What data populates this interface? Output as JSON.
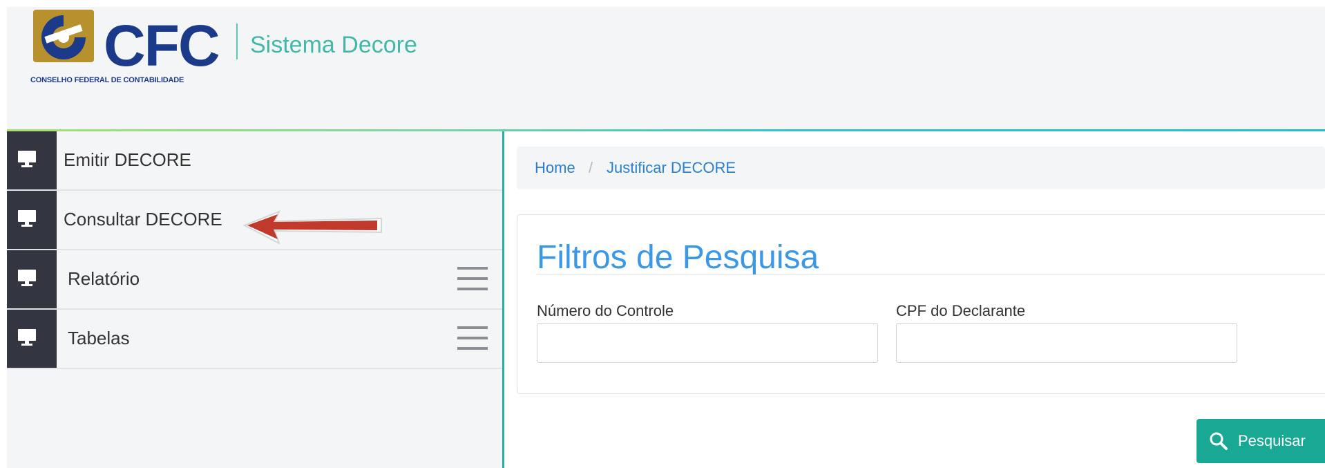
{
  "header": {
    "logo_abbr": "CFC",
    "logo_full_name": "CONSELHO FEDERAL DE CONTABILIDADE",
    "app_title": "Sistema Decore"
  },
  "sidebar": {
    "items": [
      {
        "label": "Emitir DECORE",
        "icon": "monitor-icon",
        "has_menu": false
      },
      {
        "label": "Consultar DECORE",
        "icon": "monitor-icon",
        "has_menu": false
      },
      {
        "label": "Relatório",
        "icon": "monitor-icon",
        "has_menu": true
      },
      {
        "label": "Tabelas",
        "icon": "monitor-icon",
        "has_menu": true
      }
    ]
  },
  "breadcrumb": {
    "home": "Home",
    "separator": "/",
    "current": "Justificar DECORE"
  },
  "filters": {
    "title": "Filtros de Pesquisa",
    "fields": [
      {
        "label": "Número do Controle",
        "value": ""
      },
      {
        "label": "CPF do Declarante",
        "value": ""
      }
    ]
  },
  "actions": {
    "search_label": "Pesquisar",
    "search_icon": "magnifier-icon"
  },
  "colors": {
    "brand_blue": "#1b3a8a",
    "brand_gold": "#b8912f",
    "accent_teal": "#20b2a6",
    "link_blue": "#2a7fcf",
    "title_blue": "#3a98e6",
    "button_green": "#18a894",
    "sidebar_dark": "#333540",
    "arrow_red": "#c0392b"
  }
}
